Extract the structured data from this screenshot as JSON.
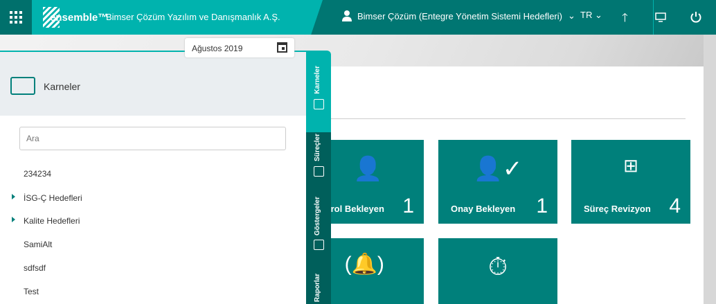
{
  "header": {
    "logo": "ensemble™",
    "company": "Bimser Çözüm Yazılım ve Danışmanlık A.Ş.",
    "user": "Bimser Çözüm (Entegre Yönetim Sistemi Hedefleri)",
    "language": "TR"
  },
  "date_picker": {
    "value": "Ağustos 2019"
  },
  "panel": {
    "title": "Karneler",
    "search_placeholder": "Ara",
    "items": [
      {
        "label": "234234",
        "expandable": false
      },
      {
        "label": "İSG-Ç Hedefleri",
        "expandable": true
      },
      {
        "label": "Kalite Hedefleri",
        "expandable": true
      },
      {
        "label": "SamiAlt",
        "expandable": false
      },
      {
        "label": "sdfsdf",
        "expandable": false
      },
      {
        "label": "Test",
        "expandable": false
      }
    ]
  },
  "side_tabs": [
    "Karneler",
    "Süreçler",
    "Göstergeler",
    "Raporlar"
  ],
  "tiles": [
    {
      "label": "Kontrol Bekleyen",
      "count": "1"
    },
    {
      "label": "Onay Bekleyen",
      "count": "1"
    },
    {
      "label": "Süreç Revizyon",
      "count": "4"
    }
  ],
  "colors": {
    "teal": "#00b3ae",
    "dark_teal": "#007672",
    "tile": "#00807b"
  }
}
